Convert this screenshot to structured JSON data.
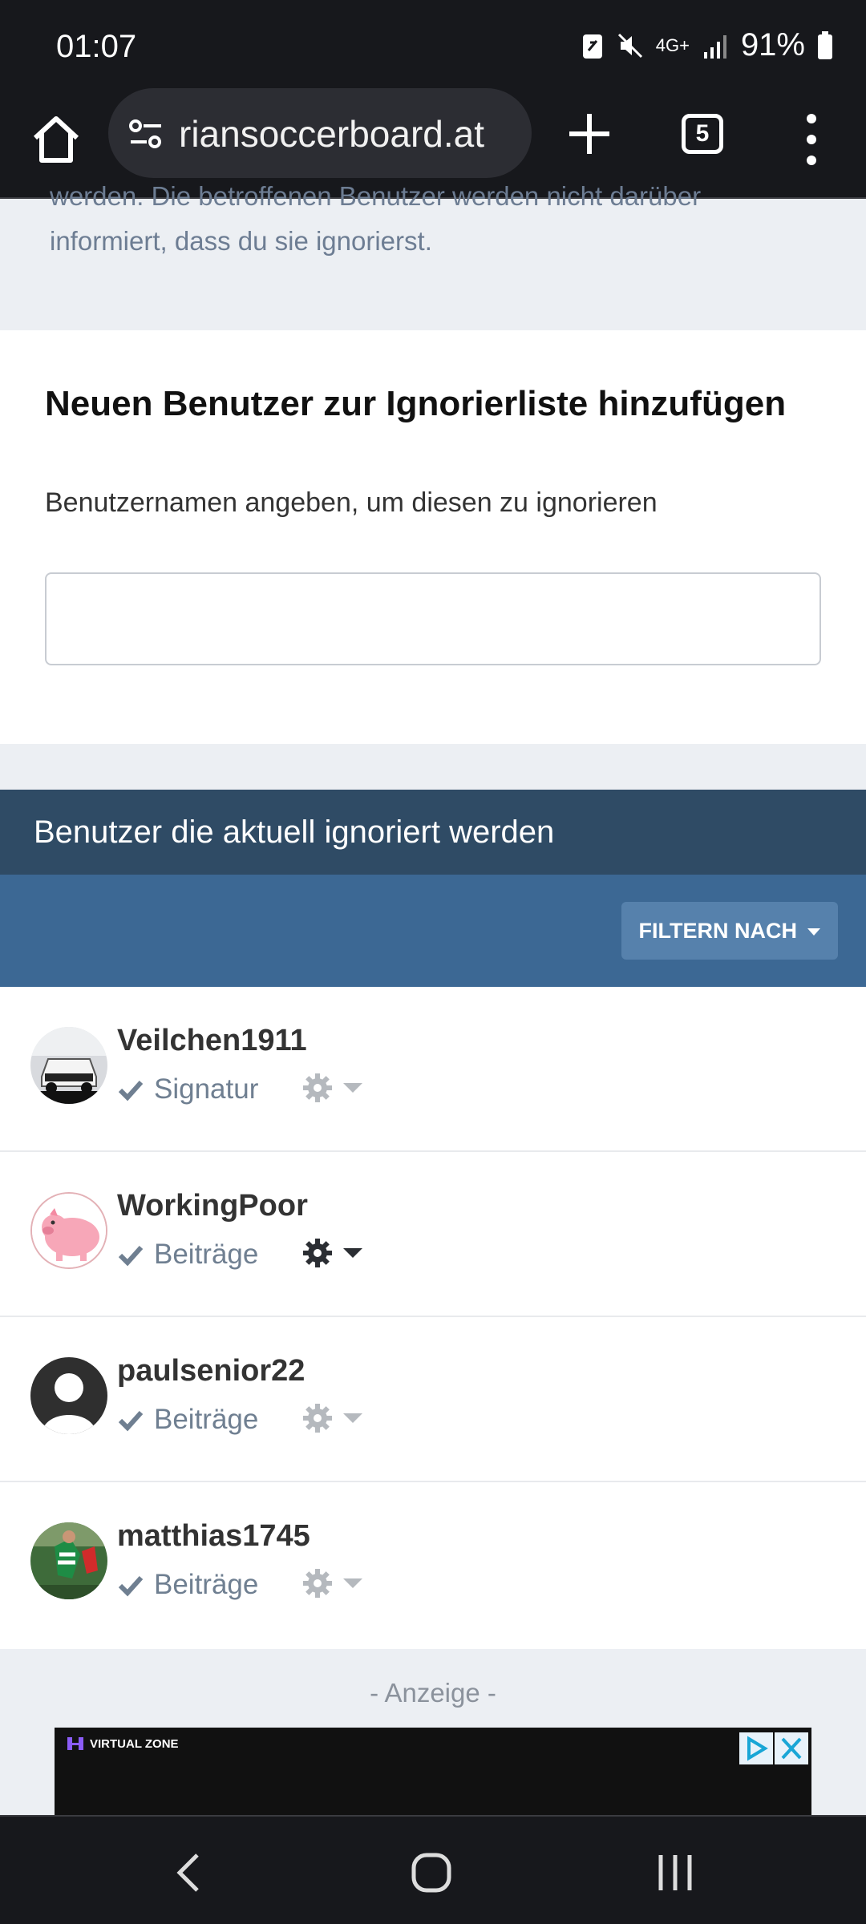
{
  "status_bar": {
    "time": "01:07",
    "network": "4G+",
    "battery": "91%"
  },
  "browser": {
    "url": "riansoccerboard.at",
    "tab_count": "5"
  },
  "intro": {
    "cut_text": "werden. Die betroffenen Benutzer werden nicht darüber",
    "line2": "informiert, dass du sie ignorierst."
  },
  "add_section": {
    "title": "Neuen Benutzer zur Ignorierliste hinzufügen",
    "subtitle": "Benutzernamen angeben, um diesen zu ignorieren",
    "input_value": ""
  },
  "ignored_list": {
    "header": "Benutzer die aktuell ignoriert werden",
    "filter_label": "FILTERN NACH",
    "users": [
      {
        "name": "Veilchen1911",
        "type": "Signatur",
        "gear_active": false
      },
      {
        "name": "WorkingPoor",
        "type": "Beiträge",
        "gear_active": true
      },
      {
        "name": "paulsenior22",
        "type": "Beiträge",
        "gear_active": false
      },
      {
        "name": "matthias1745",
        "type": "Beiträge",
        "gear_active": false
      }
    ]
  },
  "ad": {
    "label": "- Anzeige -",
    "brand": "VIRTUAL ZONE"
  },
  "colors": {
    "header_dark": "#2f4b65",
    "filter_bar": "#3c6894",
    "filter_button": "#5681ac",
    "muted_text": "#6f7f91"
  }
}
